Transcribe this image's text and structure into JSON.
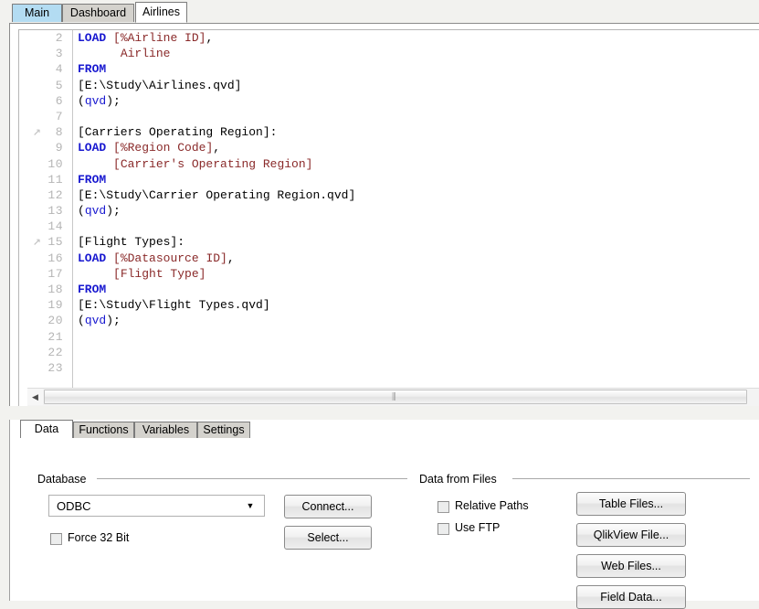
{
  "script_tabs": [
    {
      "label": "Main",
      "state": "normal"
    },
    {
      "label": "Dashboard",
      "state": "normal"
    },
    {
      "label": "Airlines",
      "state": "active"
    }
  ],
  "editor": {
    "lines": [
      {
        "num": "2",
        "marker": false,
        "tokens": [
          {
            "t": "LOAD",
            "c": "kw"
          },
          {
            "t": " ",
            "c": "pln"
          },
          {
            "t": "[%Airline ID]",
            "c": "fld"
          },
          {
            "t": ",",
            "c": "pln"
          }
        ]
      },
      {
        "num": "3",
        "marker": false,
        "tokens": [
          {
            "t": "      ",
            "c": "pln"
          },
          {
            "t": "Airline",
            "c": "fld"
          }
        ]
      },
      {
        "num": "4",
        "marker": false,
        "tokens": [
          {
            "t": "FROM",
            "c": "kw"
          }
        ]
      },
      {
        "num": "5",
        "marker": false,
        "tokens": [
          {
            "t": "[E:\\Study\\Airlines.qvd]",
            "c": "pln"
          }
        ]
      },
      {
        "num": "6",
        "marker": false,
        "tokens": [
          {
            "t": "(",
            "c": "pln"
          },
          {
            "t": "qvd",
            "c": "fn"
          },
          {
            "t": ");",
            "c": "pln"
          }
        ]
      },
      {
        "num": "7",
        "marker": false,
        "tokens": []
      },
      {
        "num": "8",
        "marker": true,
        "tokens": [
          {
            "t": "[Carriers Operating Region]:",
            "c": "pln"
          }
        ]
      },
      {
        "num": "9",
        "marker": false,
        "tokens": [
          {
            "t": "LOAD",
            "c": "kw"
          },
          {
            "t": " ",
            "c": "pln"
          },
          {
            "t": "[%Region Code]",
            "c": "fld"
          },
          {
            "t": ",",
            "c": "pln"
          }
        ]
      },
      {
        "num": "10",
        "marker": false,
        "tokens": [
          {
            "t": "     ",
            "c": "pln"
          },
          {
            "t": "[Carrier's Operating Region]",
            "c": "fld"
          }
        ]
      },
      {
        "num": "11",
        "marker": false,
        "tokens": [
          {
            "t": "FROM",
            "c": "kw"
          }
        ]
      },
      {
        "num": "12",
        "marker": false,
        "tokens": [
          {
            "t": "[E:\\Study\\Carrier Operating Region.qvd]",
            "c": "pln"
          }
        ]
      },
      {
        "num": "13",
        "marker": false,
        "tokens": [
          {
            "t": "(",
            "c": "pln"
          },
          {
            "t": "qvd",
            "c": "fn"
          },
          {
            "t": ");",
            "c": "pln"
          }
        ]
      },
      {
        "num": "14",
        "marker": false,
        "tokens": []
      },
      {
        "num": "15",
        "marker": true,
        "tokens": [
          {
            "t": "[Flight Types]:",
            "c": "pln"
          }
        ]
      },
      {
        "num": "16",
        "marker": false,
        "tokens": [
          {
            "t": "LOAD",
            "c": "kw"
          },
          {
            "t": " ",
            "c": "pln"
          },
          {
            "t": "[%Datasource ID]",
            "c": "fld"
          },
          {
            "t": ",",
            "c": "pln"
          }
        ]
      },
      {
        "num": "17",
        "marker": false,
        "tokens": [
          {
            "t": "     ",
            "c": "pln"
          },
          {
            "t": "[Flight Type]",
            "c": "fld"
          }
        ]
      },
      {
        "num": "18",
        "marker": false,
        "tokens": [
          {
            "t": "FROM",
            "c": "kw"
          }
        ]
      },
      {
        "num": "19",
        "marker": false,
        "tokens": [
          {
            "t": "[E:\\Study\\Flight Types.qvd]",
            "c": "pln"
          }
        ]
      },
      {
        "num": "20",
        "marker": false,
        "tokens": [
          {
            "t": "(",
            "c": "pln"
          },
          {
            "t": "qvd",
            "c": "fn"
          },
          {
            "t": ");",
            "c": "pln"
          }
        ]
      },
      {
        "num": "21",
        "marker": false,
        "tokens": []
      },
      {
        "num": "22",
        "marker": false,
        "tokens": []
      },
      {
        "num": "23",
        "marker": false,
        "tokens": []
      }
    ],
    "marker_glyph": "↗",
    "scrollbar": {
      "left_arrow": "◀",
      "grip": "⫼"
    }
  },
  "lower_tabs": [
    {
      "label": "Data",
      "state": "active"
    },
    {
      "label": "Functions",
      "state": "normal"
    },
    {
      "label": "Variables",
      "state": "normal"
    },
    {
      "label": "Settings",
      "state": "normal"
    }
  ],
  "database": {
    "group_label": "Database",
    "source_select": {
      "value": "ODBC",
      "arrow": "▼"
    },
    "force_32bit": {
      "label": "Force 32 Bit",
      "checked": false
    },
    "connect_button": "Connect...",
    "select_button": "Select..."
  },
  "data_from_files": {
    "group_label": "Data from Files",
    "relative_paths": {
      "label": "Relative Paths",
      "checked": false
    },
    "use_ftp": {
      "label": "Use FTP",
      "checked": false
    },
    "buttons": [
      "Table Files...",
      "QlikView File...",
      "Web Files...",
      "Field Data..."
    ]
  },
  "colors": {
    "keyword": "#1818d0",
    "field": "#8a2a2a",
    "active_tab_bg": "#ffffff",
    "selected_tab_bg": "#b3dcf2",
    "inactive_tab_bg": "#d4d2cd",
    "window_bg": "#f2f2ef"
  }
}
